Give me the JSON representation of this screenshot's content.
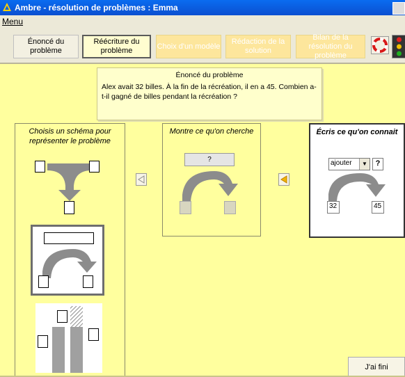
{
  "window": {
    "title": "Ambre - résolution de problèmes : Emma"
  },
  "menu": {
    "label": "Menu"
  },
  "tabs": [
    {
      "label": "Énoncé du problème",
      "state": "normal"
    },
    {
      "label": "Réécriture du problème",
      "state": "active"
    },
    {
      "label": "Choix d'un modèle",
      "state": "disabled"
    },
    {
      "label": "Rédaction de la solution",
      "state": "disabled"
    },
    {
      "label": "Bilan de la résolution du problème",
      "state": "disabled"
    }
  ],
  "icons": {
    "help": "lifebuoy-icon",
    "status": "traffic-light-icon"
  },
  "problem": {
    "title": "Énoncé du problème",
    "text": "Alex avait 32 billes. À la fin de la récréation, il en a 45. Combien a-t-il gagné de billes pendant la récréation ?"
  },
  "schemas_panel": {
    "title": "Choisis un schéma pour représenter le problème"
  },
  "search_panel": {
    "title": "Montre ce qu'on cherche",
    "unknown": "?"
  },
  "known_panel": {
    "title": "Écris ce qu'on connait",
    "operation": "ajouter",
    "unknown_button": "?",
    "start_value": "32",
    "end_value": "45"
  },
  "finish_button": "J'ai fini",
  "colors": {
    "background": "#ffff9e",
    "title_bar": "#0b5fe0",
    "arrow_gray": "#8c8c8c",
    "disabled_tab": "#fde69c",
    "arrow_button_active": "#f0b400"
  }
}
